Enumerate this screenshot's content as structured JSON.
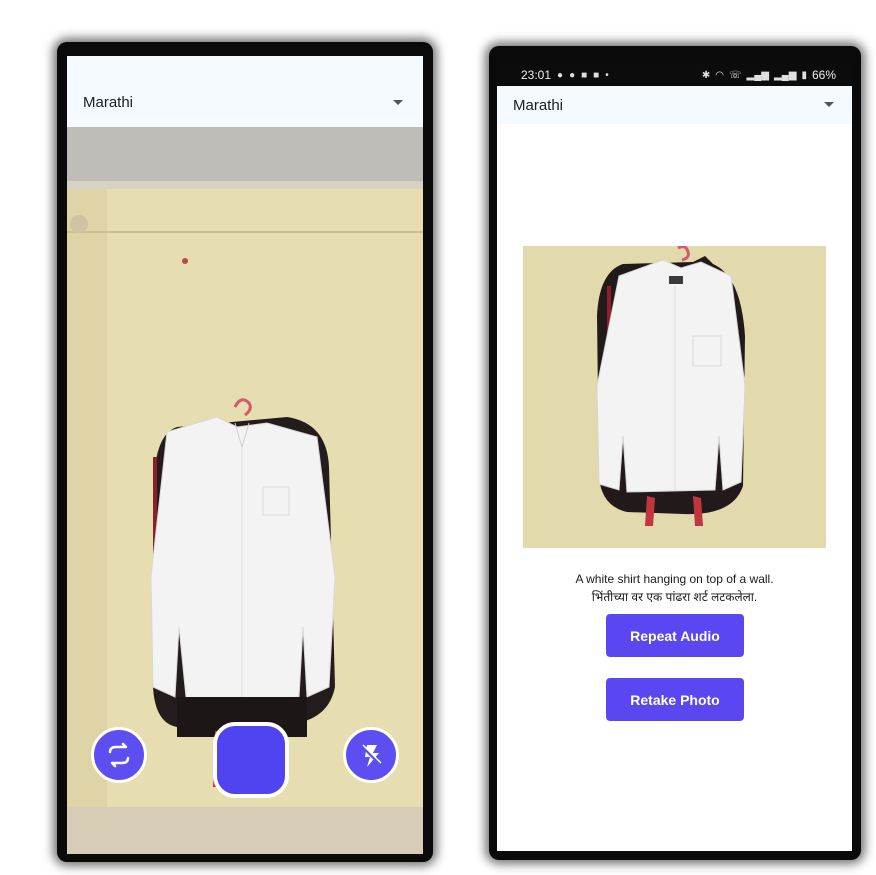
{
  "left_screen": {
    "language_selector": {
      "value": "Marathi"
    },
    "camera": {
      "switch_camera_icon": "switch-camera-icon",
      "shutter_icon": "shutter-button",
      "flash_icon": "flash-off-icon"
    }
  },
  "right_screen": {
    "status_bar": {
      "time": "23:01",
      "left_icons": [
        "chat-icon",
        "location-icon",
        "youtube-icon",
        "youtube-icon",
        "dot-icon"
      ],
      "right_icons": [
        "bluetooth-icon",
        "wifi-icon",
        "wifi-calling-icon",
        "signal-icon",
        "signal-icon",
        "battery-icon"
      ],
      "battery": "66%"
    },
    "language_selector": {
      "value": "Marathi"
    },
    "caption_english": "A white shirt hanging on top of a wall.",
    "caption_marathi": "भिंतीच्या वर एक पांढरा शर्ट लटकलेला.",
    "repeat_audio_label": "Repeat Audio",
    "retake_photo_label": "Retake Photo"
  },
  "colors": {
    "accent": "#5a47f1",
    "lang_bar_bg": "#f4fafd",
    "wall": "#e6ddb0",
    "shirt": "#f3f3f3"
  }
}
